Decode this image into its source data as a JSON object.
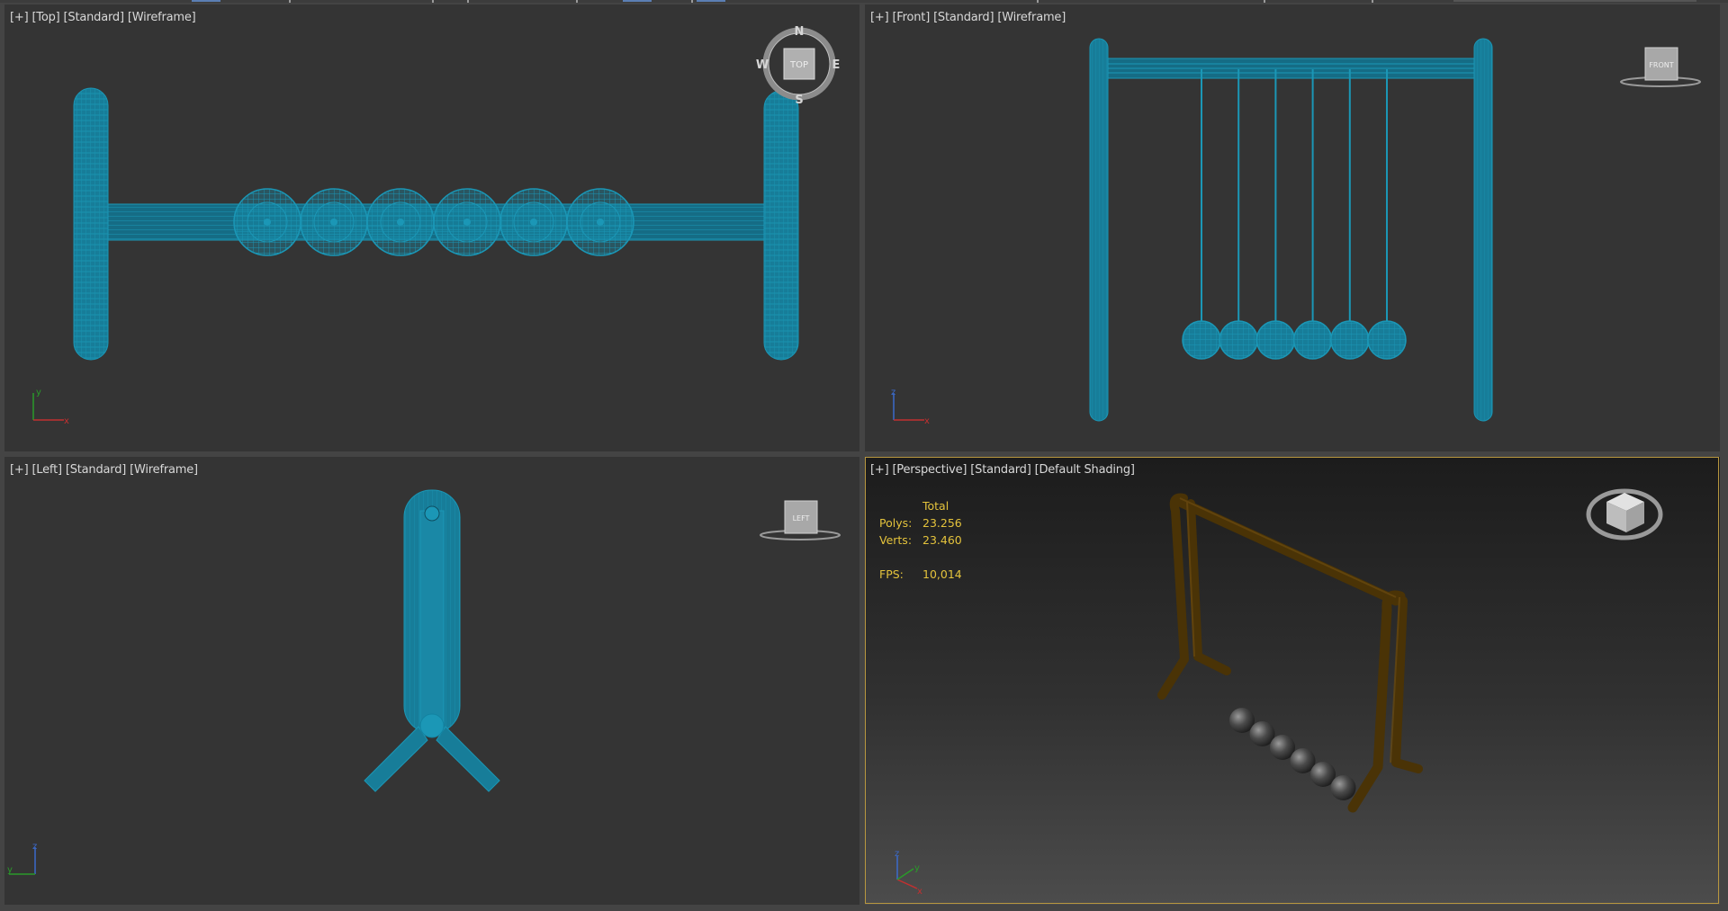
{
  "viewports": {
    "top": {
      "labels": [
        "[+]",
        "[Top]",
        "[Standard]",
        "[Wireframe]"
      ],
      "navcube": "TOP",
      "compass": {
        "n": "N",
        "s": "S",
        "e": "E",
        "w": "W"
      },
      "axes": {
        "v": "y",
        "h": "x"
      }
    },
    "front": {
      "labels": [
        "[+]",
        "[Front]",
        "[Standard]",
        "[Wireframe]"
      ],
      "navcube": "FRONT",
      "axes": {
        "v": "z",
        "h": "x"
      }
    },
    "left": {
      "labels": [
        "[+]",
        "[Left]",
        "[Standard]",
        "[Wireframe]"
      ],
      "navcube": "LEFT",
      "axes": {
        "v": "z",
        "h": "y"
      }
    },
    "perspective": {
      "labels": [
        "[+]",
        "[Perspective]",
        "[Standard]",
        "[Default Shading]"
      ],
      "axes": {
        "v": "z",
        "h": "x",
        "d": "y"
      },
      "stats": {
        "header": "Total",
        "polys_label": "Polys:",
        "polys": "23.256",
        "verts_label": "Verts:",
        "verts": "23.460",
        "fps_label": "FPS:",
        "fps": "10,014"
      }
    }
  },
  "colors": {
    "wire": "#1c8fae",
    "frame": "#4a3306",
    "active_border": "#b8973f",
    "stats": "#e4c33c"
  }
}
